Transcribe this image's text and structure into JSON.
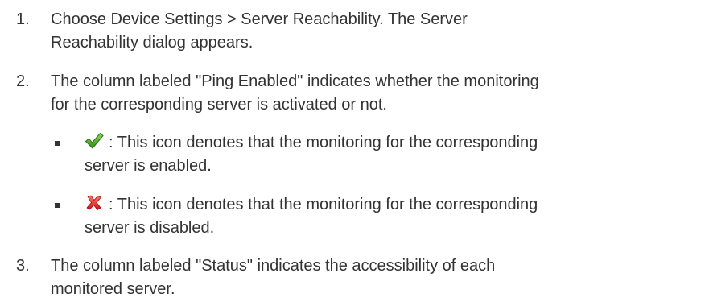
{
  "steps": [
    {
      "number": "1.",
      "line1": "Choose Device Settings > Server Reachability. The Server",
      "line2": "Reachability dialog appears."
    },
    {
      "number": "2.",
      "line1": "The column labeled \"Ping Enabled\" indicates whether the monitoring",
      "line2": "for the corresponding server is activated or not.",
      "bullets": [
        {
          "icon": "green-checkmark-icon",
          "line1": ": This icon denotes that the monitoring for the corresponding",
          "line2": "server is enabled."
        },
        {
          "icon": "red-x-icon",
          "line1": ": This icon denotes that the monitoring for the corresponding",
          "line2": "server is disabled."
        }
      ]
    },
    {
      "number": "3.",
      "line1": "The column labeled \"Status\" indicates the accessibility of each",
      "line2": "monitored server."
    }
  ],
  "colors": {
    "text": "#333333",
    "check": "#3a9a1e",
    "cross": "#e02020"
  }
}
